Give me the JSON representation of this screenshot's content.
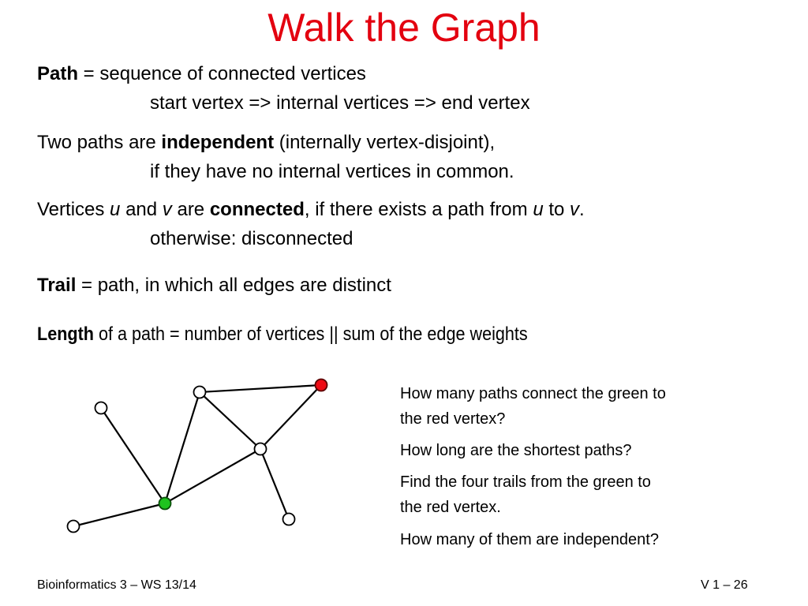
{
  "slide": {
    "title": "Walk the Graph",
    "definitions": {
      "path": {
        "term": "Path",
        "rest": " = sequence of connected vertices",
        "line2": "start vertex => internal vertices => end vertex"
      },
      "independent": {
        "pre": "Two paths are ",
        "term": "independent",
        "post": " (internally vertex-disjoint),",
        "line2": "if they have no internal vertices in common."
      },
      "connected": {
        "pre": "Vertices ",
        "u": "u",
        "and": " and ",
        "v": "v",
        "are": " are ",
        "term": "connected",
        "post": ", if there exists a path from ",
        "u2": "u",
        "to": " to ",
        "v2": "v",
        "end": ".",
        "line2": "otherwise: disconnected"
      },
      "trail": {
        "term": "Trail",
        "rest": " = path, in which all edges are distinct"
      },
      "length": {
        "term": "Length",
        "rest": " of a path = number of vertices ||  sum of the edge weights"
      }
    },
    "questions": [
      "How many paths connect the green to",
      "the red vertex?",
      "How long are the shortest paths?",
      "Find the four trails from the green to",
      "the red vertex.",
      "How many of them are independent?"
    ],
    "footer": {
      "course": "Bioinformatics 3 – WS 13/14",
      "page": "V 1 –  26"
    },
    "colors": {
      "title": "#e3000f",
      "start_vertex": "#1fc31f",
      "end_vertex": "#ee0a14",
      "vertex": "#ffffff"
    },
    "graph": {
      "vertices": [
        {
          "id": "a",
          "role": "plain"
        },
        {
          "id": "b",
          "role": "plain"
        },
        {
          "id": "red",
          "role": "end"
        },
        {
          "id": "c",
          "role": "plain"
        },
        {
          "id": "green",
          "role": "start"
        },
        {
          "id": "d",
          "role": "plain"
        },
        {
          "id": "e",
          "role": "plain"
        }
      ],
      "edges": [
        [
          "a",
          "green"
        ],
        [
          "b",
          "green"
        ],
        [
          "b",
          "red"
        ],
        [
          "b",
          "c"
        ],
        [
          "c",
          "red"
        ],
        [
          "c",
          "green"
        ],
        [
          "c",
          "e"
        ],
        [
          "d",
          "green"
        ]
      ]
    }
  }
}
